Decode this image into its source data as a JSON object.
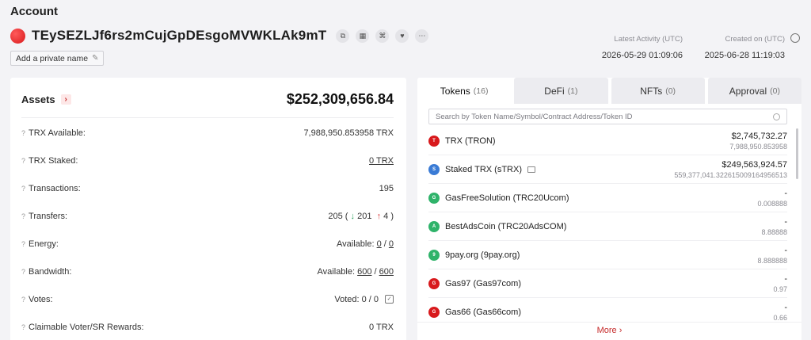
{
  "header": {
    "title": "Account",
    "address": "TEySEZLJf6rs2mCujGpDEsgoMVWKLAk9mT",
    "private_name_label": "Add a private name",
    "latest_activity_label": "Latest Activity (UTC)",
    "latest_activity_value": "2026-05-29 01:09:06",
    "created_on_label": "Created on (UTC)",
    "created_on_value": "2025-06-28 11:19:03"
  },
  "assets": {
    "title": "Assets",
    "total": "$252,309,656.84",
    "rows": {
      "trx_available": {
        "label": "TRX Available:",
        "value": "7,988,950.853958 TRX"
      },
      "trx_staked": {
        "label": "TRX Staked:",
        "value": "0 TRX"
      },
      "transactions": {
        "label": "Transactions:",
        "value": "195"
      },
      "transfers": {
        "label": "Transfers:",
        "total": "205",
        "in": "201",
        "out": "4"
      },
      "energy": {
        "label": "Energy:",
        "prefix": "Available:",
        "used": "0",
        "total": "0"
      },
      "bandwidth": {
        "label": "Bandwidth:",
        "prefix": "Available:",
        "used": "600",
        "total": "600"
      },
      "votes": {
        "label": "Votes:",
        "value": "Voted: 0 / 0"
      },
      "rewards": {
        "label": "Claimable Voter/SR Rewards:",
        "value": "0 TRX"
      }
    }
  },
  "tabs": [
    {
      "label": "Tokens",
      "count": "(16)"
    },
    {
      "label": "DeFi",
      "count": "(1)"
    },
    {
      "label": "NFTs",
      "count": "(0)"
    },
    {
      "label": "Approval",
      "count": "(0)"
    }
  ],
  "search": {
    "placeholder": "Search by Token Name/Symbol/Contract Address/Token ID"
  },
  "tokens": [
    {
      "name": "TRX (TRON)",
      "value": "$2,745,732.27",
      "amount": "7,988,950.853958",
      "color": "#d8191c"
    },
    {
      "name": "Staked TRX (sTRX)",
      "value": "$249,563,924.57",
      "amount": "559,377,041.322615009164956513",
      "color": "#3a7bd5"
    },
    {
      "name": "GasFreeSolution (TRC20Ucom)",
      "value": "-",
      "amount": "0.008888",
      "color": "#2fb36a"
    },
    {
      "name": "BestAdsCoin (TRC20AdsCOM)",
      "value": "-",
      "amount": "8.88888",
      "color": "#2fb36a"
    },
    {
      "name": "9pay.org (9pay.org)",
      "value": "-",
      "amount": "8.888888",
      "color": "#2fb36a"
    },
    {
      "name": "Gas97 (Gas97com)",
      "value": "-",
      "amount": "0.97",
      "color": "#d8191c"
    },
    {
      "name": "Gas66 (Gas66com)",
      "value": "-",
      "amount": "0.66",
      "color": "#d8191c"
    }
  ],
  "more_label": "More"
}
